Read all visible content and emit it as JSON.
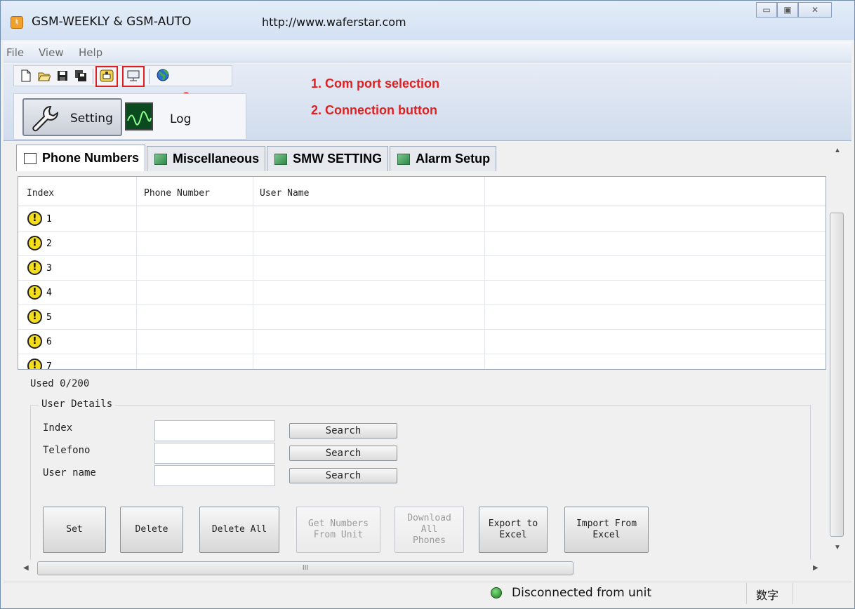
{
  "window": {
    "title": "GSM-WEEKLY & GSM-AUTO",
    "url": "http://www.waferstar.com",
    "buttons": [
      "minimize",
      "maximize",
      "close"
    ]
  },
  "menu": [
    "File",
    "View",
    "Help"
  ],
  "toolbar": {
    "icons": [
      "new-file-icon",
      "open-folder-icon",
      "save-icon",
      "save-all-icon",
      "com-port-icon",
      "connection-icon",
      "globe-icon"
    ],
    "marker_1": "1",
    "marker_2": "2"
  },
  "annotations": {
    "line1": "1. Com port selection",
    "line2": "2. Connection button"
  },
  "mode": {
    "setting_label": "Setting",
    "log_label": "Log"
  },
  "tabs": [
    "Phone Numbers",
    "Miscellaneous",
    "SMW SETTING",
    "Alarm Setup"
  ],
  "table": {
    "columns": [
      "Index",
      "Phone Number",
      "User Name"
    ],
    "rows": [
      "1",
      "2",
      "3",
      "4",
      "5",
      "6",
      "7"
    ]
  },
  "used": "Used 0/200",
  "user_details": {
    "legend": "User Details",
    "fields": [
      {
        "label": "Index",
        "value": "",
        "button": "Search"
      },
      {
        "label": "Telefono",
        "value": "",
        "button": "Search"
      },
      {
        "label": "User name",
        "value": "",
        "button": "Search"
      }
    ]
  },
  "actions": [
    {
      "label": "Set",
      "enabled": true
    },
    {
      "label": "Delete",
      "enabled": true
    },
    {
      "label": "Delete All",
      "enabled": true
    },
    {
      "label": "Get Numbers\nFrom Unit",
      "enabled": false
    },
    {
      "label": "Download\nAll\nPhones",
      "enabled": false
    },
    {
      "label": "Export to\nExcel",
      "enabled": true
    },
    {
      "label": "Import From\nExcel",
      "enabled": true
    }
  ],
  "scroll": {
    "h_thumb_glyph": "III"
  },
  "status": {
    "connection": "Disconnected from unit",
    "input_mode": "数字"
  },
  "colors": {
    "annotation": "#e02020",
    "status_ok": "#1b7a1b",
    "warn": "#f4de1c"
  }
}
